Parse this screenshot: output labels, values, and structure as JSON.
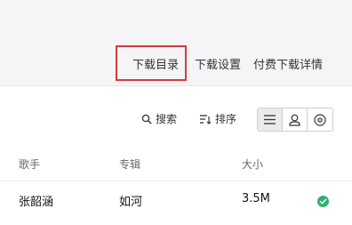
{
  "tabs": {
    "downloads": "下载目录",
    "settings": "下载设置",
    "paid": "付费下载详情"
  },
  "toolbar": {
    "search_label": "搜索",
    "sort_label": "排序",
    "views": [
      "list-icon",
      "user-icon",
      "disc-icon"
    ],
    "active_view": "list-icon"
  },
  "table": {
    "columns": [
      "歌手",
      "专辑",
      "大小"
    ],
    "rows": [
      {
        "artist": "张韶涵",
        "album": "如河",
        "size": "3.5M",
        "status": "downloaded"
      }
    ]
  },
  "colors": {
    "highlight": "#d23b3b",
    "success": "#32b06f"
  }
}
